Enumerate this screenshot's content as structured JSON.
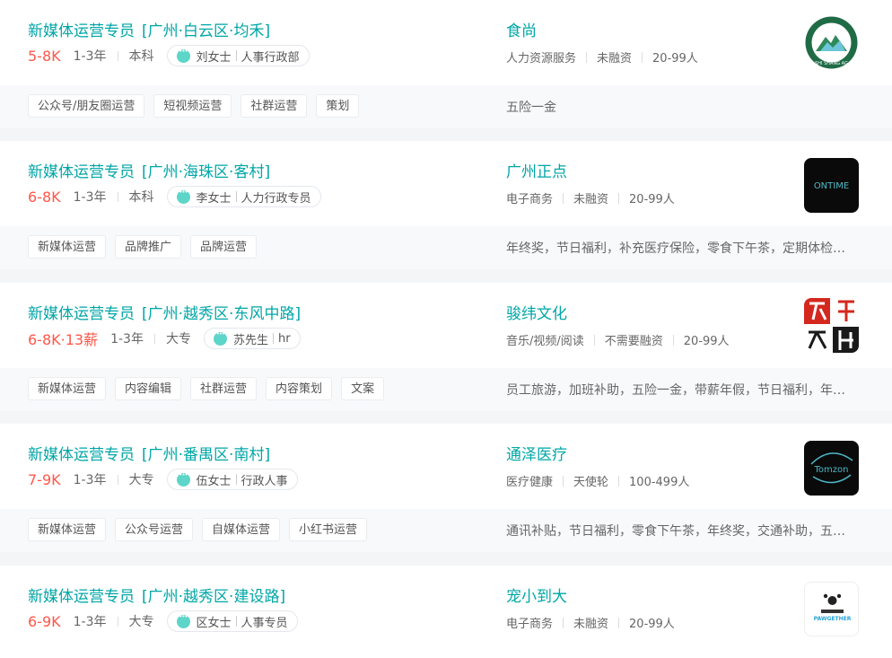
{
  "jobs": [
    {
      "title": "新媒体运营专员",
      "area": "[广州·白云区·均禾]",
      "salary": "5-8K",
      "experience": "1-3年",
      "degree": "本科",
      "recruiter_name": "刘女士",
      "recruiter_title": "人事行政部",
      "skills": [
        "公众号/朋友圈运营",
        "短视频运营",
        "社群运营",
        "策划"
      ],
      "company": "食尚",
      "industry": "人力资源服务",
      "funding": "未融资",
      "size": "20-99人",
      "welfare": "五险一金",
      "logo_icon": "shishang-logo-icon",
      "logo_text": "SHI SHANG AG"
    },
    {
      "title": "新媒体运营专员",
      "area": "[广州·海珠区·客村]",
      "salary": "6-8K",
      "experience": "1-3年",
      "degree": "本科",
      "recruiter_name": "李女士",
      "recruiter_title": "人力行政专员",
      "skills": [
        "新媒体运营",
        "品牌推广",
        "品牌运营"
      ],
      "company": "广州正点",
      "industry": "电子商务",
      "funding": "未融资",
      "size": "20-99人",
      "welfare": "年终奖，节日福利，补充医疗保险，零食下午茶，定期体检，员工旅游",
      "logo_icon": "ontime-logo-icon",
      "logo_text": "ONTIME"
    },
    {
      "title": "新媒体运营专员",
      "area": "[广州·越秀区·东风中路]",
      "salary": "6-8K·13薪",
      "experience": "1-3年",
      "degree": "大专",
      "recruiter_name": "苏先生",
      "recruiter_title": "hr",
      "skills": [
        "新媒体运营",
        "内容编辑",
        "社群运营",
        "内容策划",
        "文案"
      ],
      "company": "骏纬文化",
      "industry": "音乐/视频/阅读",
      "funding": "不需要融资",
      "size": "20-99人",
      "welfare": "员工旅游，加班补助，五险一金，带薪年假，节日福利，年终奖",
      "logo_icon": "junwei-logo-icon",
      "logo_text": ""
    },
    {
      "title": "新媒体运营专员",
      "area": "[广州·番禺区·南村]",
      "salary": "7-9K",
      "experience": "1-3年",
      "degree": "大专",
      "recruiter_name": "伍女士",
      "recruiter_title": "行政人事",
      "skills": [
        "新媒体运营",
        "公众号运营",
        "自媒体运营",
        "小红书运营"
      ],
      "company": "通泽医疗",
      "industry": "医疗健康",
      "funding": "天使轮",
      "size": "100-499人",
      "welfare": "通讯补贴，节日福利，零食下午茶，年终奖，交通补助，五险一金",
      "logo_icon": "tomzon-logo-icon",
      "logo_text": "Tomzon"
    },
    {
      "title": "新媒体运营专员",
      "area": "[广州·越秀区·建设路]",
      "salary": "6-9K",
      "experience": "1-3年",
      "degree": "大专",
      "recruiter_name": "区女士",
      "recruiter_title": "人事专员",
      "skills": [],
      "company": "宠小到大",
      "industry": "电子商务",
      "funding": "未融资",
      "size": "20-99人",
      "welfare": "",
      "logo_icon": "pawgether-logo-icon",
      "logo_text": "PAWGETHER"
    }
  ]
}
